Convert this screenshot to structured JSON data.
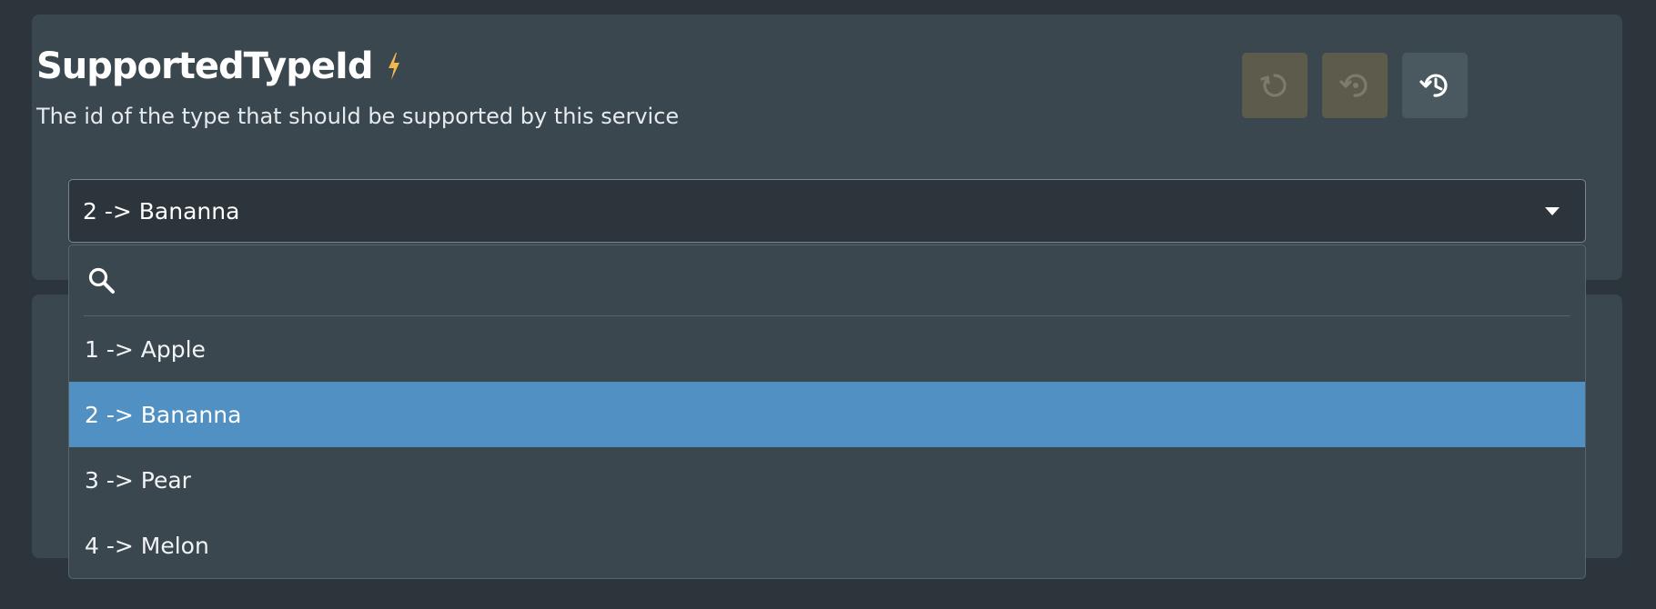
{
  "field": {
    "title": "SupportedTypeId",
    "description": "The id of the type that should be supported by this service",
    "bolt_icon": "lightning-bolt-icon",
    "accent_color": "#f2b84b"
  },
  "actions": [
    {
      "icon": "refresh-icon",
      "enabled": false
    },
    {
      "icon": "reset-default-icon",
      "enabled": false
    },
    {
      "icon": "history-icon",
      "enabled": true
    }
  ],
  "select": {
    "value": "2 -> Bananna",
    "search_placeholder": "",
    "options": [
      {
        "label": "1 -> Apple",
        "selected": false
      },
      {
        "label": "2 -> Bananna",
        "selected": true
      },
      {
        "label": "3 -> Pear",
        "selected": false
      },
      {
        "label": "4 -> Melon",
        "selected": false
      }
    ],
    "selected_color": "#5190c2"
  }
}
